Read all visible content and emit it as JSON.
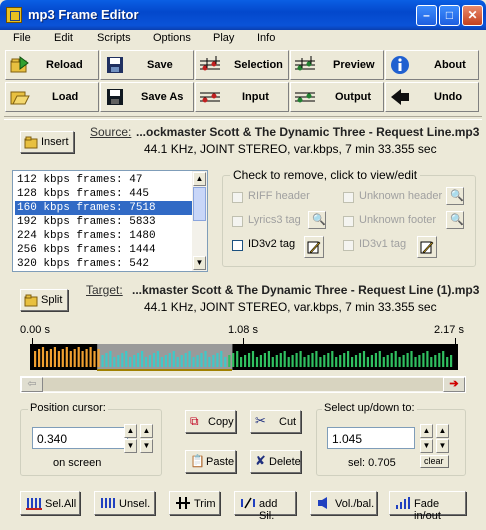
{
  "window": {
    "title": "mp3 Frame Editor"
  },
  "menu": [
    "File",
    "Edit",
    "Scripts",
    "Options",
    "Play",
    "Info"
  ],
  "toolbar": {
    "row1": [
      "Reload",
      "Save",
      "Selection",
      "Preview",
      "About"
    ],
    "row2": [
      "Load",
      "Save As",
      "Input",
      "Output",
      "Undo"
    ]
  },
  "source": {
    "button": "Insert",
    "label": "Source:",
    "file": "...ockmaster Scott & The Dynamic Three - Request Line.mp3",
    "info": "44.1 KHz, JOINT STEREO, var.kbps, 7 min 33.355 sec"
  },
  "frames": [
    "112 kbps frames: 47",
    "128 kbps frames: 445",
    "160 kbps frames: 7518",
    "192 kbps frames: 5833",
    "224 kbps frames: 1480",
    "256 kbps frames: 1444",
    "320 kbps frames: 542"
  ],
  "frames_selected_index": 2,
  "check": {
    "title": "Check to remove, click to view/edit",
    "riff": "RIFF header",
    "unknown_header": "Unknown header",
    "lyrics3": "Lyrics3 tag",
    "unknown_footer": "Unknown footer",
    "id3v2": "ID3v2 tag",
    "id3v1": "ID3v1 tag"
  },
  "target": {
    "button": "Split",
    "label": "Target:",
    "file": "...kmaster Scott & The Dynamic Three - Request Line (1).mp3",
    "info": "44.1 KHz, JOINT STEREO, var.kbps, 7 min 33.355 sec"
  },
  "timeline": {
    "t0": "0.00 s",
    "t1": "1.08 s",
    "t2": "2.17 s",
    "selection_start": 0.157,
    "selection_end": 0.473
  },
  "position": {
    "title": "Position cursor:",
    "value": "0.340",
    "note": "on screen"
  },
  "edit": {
    "copy": "Copy",
    "cut": "Cut",
    "paste": "Paste",
    "delete": "Delete"
  },
  "select": {
    "title": "Select up/down to:",
    "value": "1.045",
    "sel": "sel: 0.705",
    "clear": "clear"
  },
  "bottom": [
    "Sel.All",
    "Unsel.",
    "Trim",
    "add Sil.",
    "Vol./bal.",
    "Fade in/out"
  ],
  "colors": {
    "title_blue": "#0348cc",
    "selection": "#316ac5",
    "bar_orange": "#f0a030",
    "bar_cyan": "#40c8c8",
    "bar_green": "#30c060"
  }
}
